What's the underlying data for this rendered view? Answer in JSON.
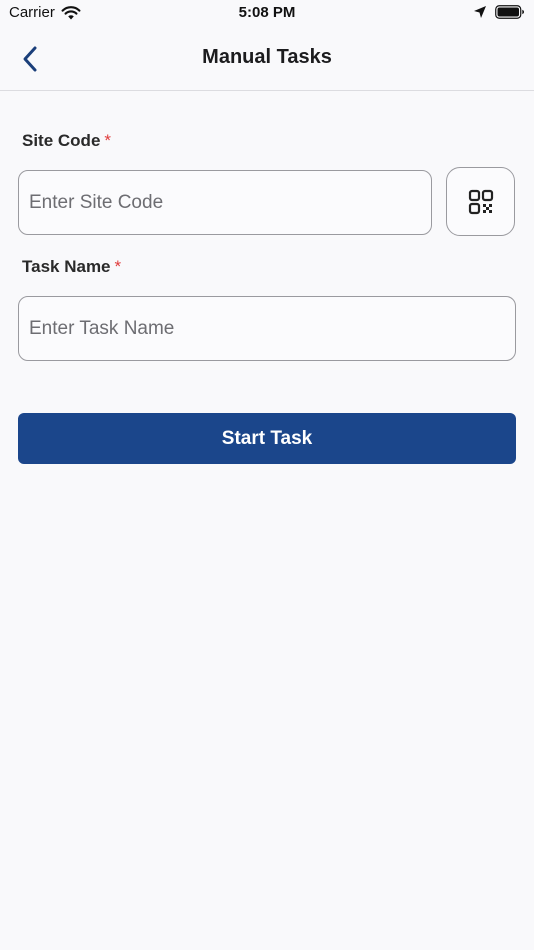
{
  "status_bar": {
    "carrier": "Carrier",
    "time": "5:08 PM",
    "icons": [
      "wifi-icon",
      "location-arrow-icon",
      "battery-icon"
    ]
  },
  "nav": {
    "title": "Manual Tasks",
    "back_icon": "chevron-left-icon"
  },
  "form": {
    "site_code": {
      "label": "Site Code",
      "required_marker": "*",
      "placeholder": "Enter Site Code",
      "value": ""
    },
    "scan_button_icon": "qr-code-icon",
    "task_name": {
      "label": "Task Name",
      "required_marker": "*",
      "placeholder": "Enter Task Name",
      "value": ""
    },
    "submit_label": "Start Task"
  },
  "colors": {
    "accent": "#1b468b",
    "required": "#e03c3c",
    "background": "#f9f9fb",
    "nav_icon": "#1b3f7a"
  }
}
